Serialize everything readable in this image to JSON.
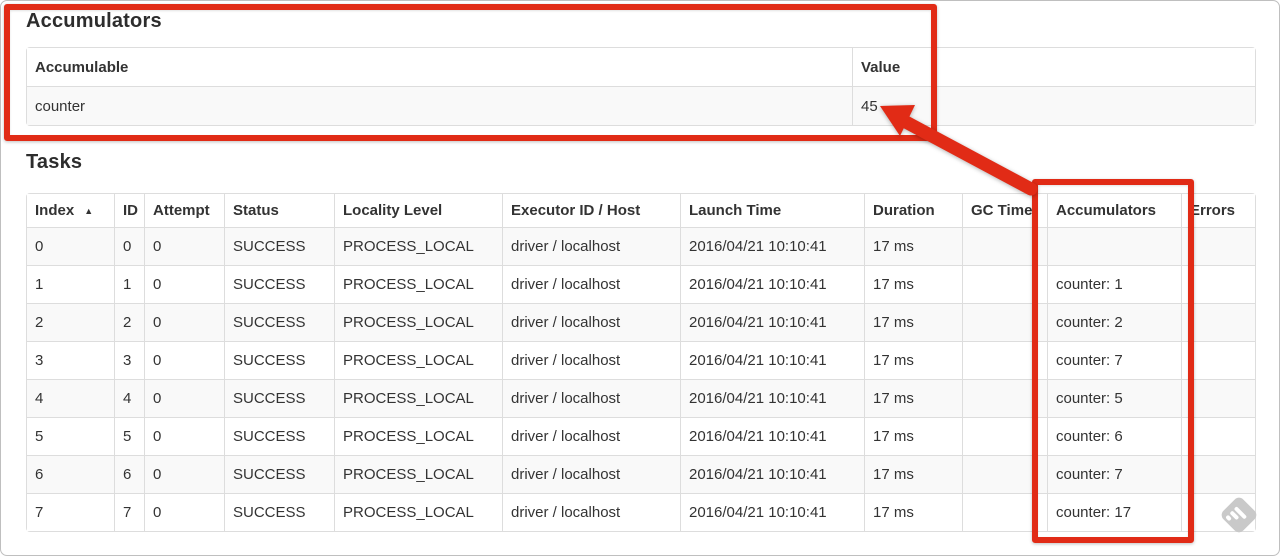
{
  "accumulators_section": {
    "title": "Accumulators",
    "headers": [
      "Accumulable",
      "Value"
    ],
    "rows": [
      {
        "accumulable": "counter",
        "value": "45"
      }
    ]
  },
  "tasks_section": {
    "title": "Tasks",
    "headers": [
      "Index",
      "ID",
      "Attempt",
      "Status",
      "Locality Level",
      "Executor ID / Host",
      "Launch Time",
      "Duration",
      "GC Time",
      "Accumulators",
      "Errors"
    ],
    "sort_indicator": "▲",
    "rows": [
      {
        "index": "0",
        "id": "0",
        "attempt": "0",
        "status": "SUCCESS",
        "locality_level": "PROCESS_LOCAL",
        "executor_id_host": "driver / localhost",
        "launch_time": "2016/04/21 10:10:41",
        "duration": "17 ms",
        "gc_time": "",
        "accumulators": "",
        "errors": ""
      },
      {
        "index": "1",
        "id": "1",
        "attempt": "0",
        "status": "SUCCESS",
        "locality_level": "PROCESS_LOCAL",
        "executor_id_host": "driver / localhost",
        "launch_time": "2016/04/21 10:10:41",
        "duration": "17 ms",
        "gc_time": "",
        "accumulators": "counter: 1",
        "errors": ""
      },
      {
        "index": "2",
        "id": "2",
        "attempt": "0",
        "status": "SUCCESS",
        "locality_level": "PROCESS_LOCAL",
        "executor_id_host": "driver / localhost",
        "launch_time": "2016/04/21 10:10:41",
        "duration": "17 ms",
        "gc_time": "",
        "accumulators": "counter: 2",
        "errors": ""
      },
      {
        "index": "3",
        "id": "3",
        "attempt": "0",
        "status": "SUCCESS",
        "locality_level": "PROCESS_LOCAL",
        "executor_id_host": "driver / localhost",
        "launch_time": "2016/04/21 10:10:41",
        "duration": "17 ms",
        "gc_time": "",
        "accumulators": "counter: 7",
        "errors": ""
      },
      {
        "index": "4",
        "id": "4",
        "attempt": "0",
        "status": "SUCCESS",
        "locality_level": "PROCESS_LOCAL",
        "executor_id_host": "driver / localhost",
        "launch_time": "2016/04/21 10:10:41",
        "duration": "17 ms",
        "gc_time": "",
        "accumulators": "counter: 5",
        "errors": ""
      },
      {
        "index": "5",
        "id": "5",
        "attempt": "0",
        "status": "SUCCESS",
        "locality_level": "PROCESS_LOCAL",
        "executor_id_host": "driver / localhost",
        "launch_time": "2016/04/21 10:10:41",
        "duration": "17 ms",
        "gc_time": "",
        "accumulators": "counter: 6",
        "errors": ""
      },
      {
        "index": "6",
        "id": "6",
        "attempt": "0",
        "status": "SUCCESS",
        "locality_level": "PROCESS_LOCAL",
        "executor_id_host": "driver / localhost",
        "launch_time": "2016/04/21 10:10:41",
        "duration": "17 ms",
        "gc_time": "",
        "accumulators": "counter: 7",
        "errors": ""
      },
      {
        "index": "7",
        "id": "7",
        "attempt": "0",
        "status": "SUCCESS",
        "locality_level": "PROCESS_LOCAL",
        "executor_id_host": "driver / localhost",
        "launch_time": "2016/04/21 10:10:41",
        "duration": "17 ms",
        "gc_time": "",
        "accumulators": "counter: 17",
        "errors": ""
      }
    ]
  },
  "annotations": {
    "color": "#e12b16"
  },
  "colors": {
    "table_border": "#dddddd",
    "stripe_row": "#f9f9f9",
    "text": "#333333",
    "watermark_gray": "#c9c9c9"
  },
  "icons": {
    "sort_ascending_icon": "▲",
    "watermark_icon": "gray-diamond-logo"
  }
}
